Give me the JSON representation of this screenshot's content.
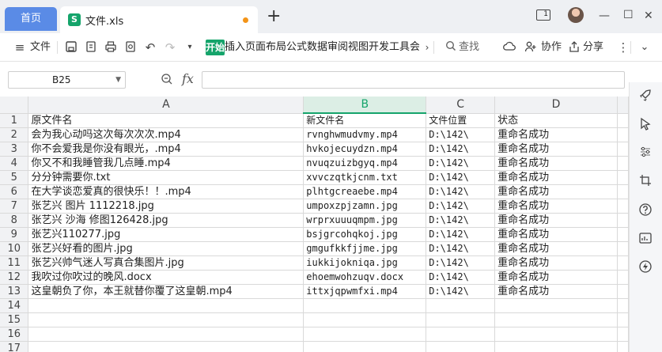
{
  "tabs": {
    "home": "首页",
    "file": "文件.xls",
    "file_icon": "S"
  },
  "toolbar": {
    "menu_label": "文件",
    "start_label": "开始",
    "menu_strip": "插入页面布局公式数据审阅视图开发工具会员专",
    "search_label": "查找",
    "collab_label": "协作",
    "share_label": "分享"
  },
  "formula": {
    "cell_ref": "B25",
    "fx_label": "fx",
    "value": ""
  },
  "sheet": {
    "columns": [
      "A",
      "B",
      "C",
      "D"
    ],
    "selected_column": "B",
    "rows": [
      {
        "n": "1",
        "a": "原文件名",
        "b": "新文件名",
        "c": "文件位置",
        "d": "状态"
      },
      {
        "n": "2",
        "a": "会为我心动吗这次每次次次.mp4",
        "b": "rvnghwmudvmy.mp4",
        "c": "D:\\142\\",
        "d": "重命名成功"
      },
      {
        "n": "3",
        "a": "你不会爱我是你没有眼光，.mp4",
        "b": "hvkojecuydzn.mp4",
        "c": "D:\\142\\",
        "d": "重命名成功"
      },
      {
        "n": "4",
        "a": "你又不和我睡管我几点睡.mp4",
        "b": "nvuqzuizbgyq.mp4",
        "c": "D:\\142\\",
        "d": "重命名成功"
      },
      {
        "n": "5",
        "a": "分分钟需要你.txt",
        "b": "xvvczqtkjcnm.txt",
        "c": "D:\\142\\",
        "d": "重命名成功"
      },
      {
        "n": "6",
        "a": "在大学谈恋爱真的很快乐！！.mp4",
        "b": "plhtgcreaebe.mp4",
        "c": "D:\\142\\",
        "d": "重命名成功"
      },
      {
        "n": "7",
        "a": "张艺兴 图片 1112218.jpg",
        "b": "umpoxzpjzamn.jpg",
        "c": "D:\\142\\",
        "d": "重命名成功"
      },
      {
        "n": "8",
        "a": "张艺兴 沙海 修图126428.jpg",
        "b": "wrprxuuuqmpm.jpg",
        "c": "D:\\142\\",
        "d": "重命名成功"
      },
      {
        "n": "9",
        "a": "张艺兴110277.jpg",
        "b": "bsjgrcohqkoj.jpg",
        "c": "D:\\142\\",
        "d": "重命名成功"
      },
      {
        "n": "10",
        "a": "张艺兴好看的图片.jpg",
        "b": "gmgufkkfjjme.jpg",
        "c": "D:\\142\\",
        "d": "重命名成功"
      },
      {
        "n": "11",
        "a": "张艺兴帅气迷人写真合集图片.jpg",
        "b": "iukkijokniqa.jpg",
        "c": "D:\\142\\",
        "d": "重命名成功"
      },
      {
        "n": "12",
        "a": "我吹过你吹过的晚风.docx",
        "b": "ehoemwohzuqv.docx",
        "c": "D:\\142\\",
        "d": "重命名成功"
      },
      {
        "n": "13",
        "a": "这皇朝负了你，本王就替你覆了这皇朝.mp4",
        "b": "ittxjqpwmfxi.mp4",
        "c": "D:\\142\\",
        "d": "重命名成功"
      },
      {
        "n": "14",
        "a": "",
        "b": "",
        "c": "",
        "d": ""
      },
      {
        "n": "15",
        "a": "",
        "b": "",
        "c": "",
        "d": ""
      },
      {
        "n": "16",
        "a": "",
        "b": "",
        "c": "",
        "d": ""
      },
      {
        "n": "17",
        "a": "",
        "b": "",
        "c": "",
        "d": ""
      }
    ]
  },
  "colors": {
    "accent": "#15a46b",
    "home_tab": "#5a8be6",
    "unsaved_dot": "#f39418"
  }
}
